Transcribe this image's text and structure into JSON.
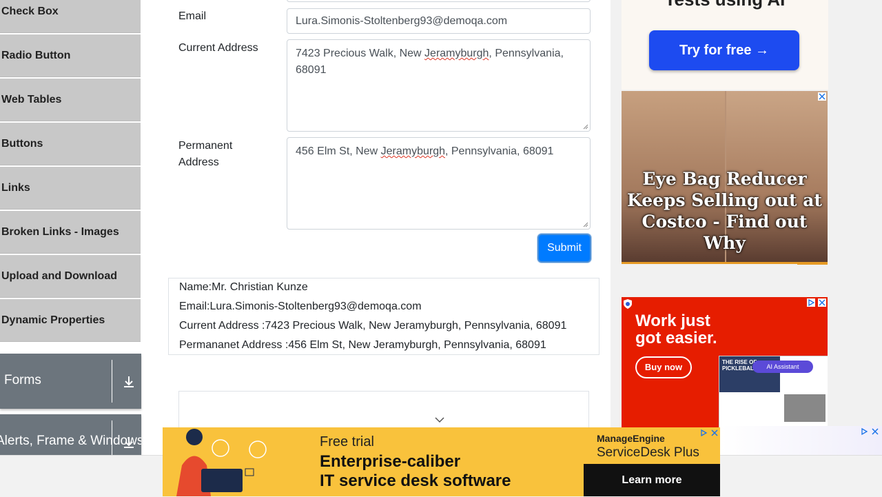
{
  "sidebar": {
    "items": [
      {
        "label": "Check Box"
      },
      {
        "label": "Radio Button"
      },
      {
        "label": "Web Tables"
      },
      {
        "label": "Buttons"
      },
      {
        "label": "Links"
      },
      {
        "label": "Broken Links - Images"
      },
      {
        "label": "Upload and Download"
      },
      {
        "label": "Dynamic Properties"
      }
    ],
    "groups": [
      {
        "label": "Forms"
      },
      {
        "label": "Alerts, Frame & Windows"
      }
    ]
  },
  "form": {
    "email_label": "Email",
    "email_value": "Lura.Simonis-Stoltenberg93@demoqa.com",
    "current_label": "Current Address",
    "current_value_a": "7423 Precious Walk, New ",
    "current_value_b": "Jeramyburgh",
    "current_value_c": ", Pennsylvania, 68091",
    "permanent_label": "Permanent Address",
    "permanent_value_a": "456 Elm St, New ",
    "permanent_value_b": "Jeramyburgh",
    "permanent_value_c": ", Pennsylvania, 68091",
    "submit_label": "Submit"
  },
  "output": {
    "name": "Name:Mr. Christian Kunze",
    "email": "Email:Lura.Simonis-Stoltenberg93@demoqa.com",
    "current": "Current Address :7423 Precious Walk, New Jeramyburgh, Pennsylvania, 68091",
    "permanent": "Permananet Address :456 Elm St, New Jeramyburgh, Pennsylvania, 68091"
  },
  "ads": {
    "top_partial_text": "Tests using AI",
    "top_cta": "Try for free →",
    "eyebag_text": "Eye Bag Reducer Keeps Selling out at Costco - Find out Why",
    "work_title_1": "Work just",
    "work_title_2": "got easier.",
    "work_cta": "Buy now",
    "work_doc_title": "THE RISE OF PICKLEBALL",
    "work_ai_badge": "AI Assistant",
    "bottom_free": "Free trial",
    "bottom_line1": "Enterprise-caliber",
    "bottom_line2": "IT service desk software",
    "bottom_brand1": "ManageEngine",
    "bottom_brand2": "ServiceDesk Plus",
    "bottom_cta": "Learn more"
  },
  "colors": {
    "primary": "#007bff",
    "sidebar_item": "#c8c8c8",
    "group_bg": "#6c757d",
    "ad_red": "#e61d00",
    "ad_yellow": "#f9c23c",
    "ad_blue": "#1d4bf0"
  }
}
